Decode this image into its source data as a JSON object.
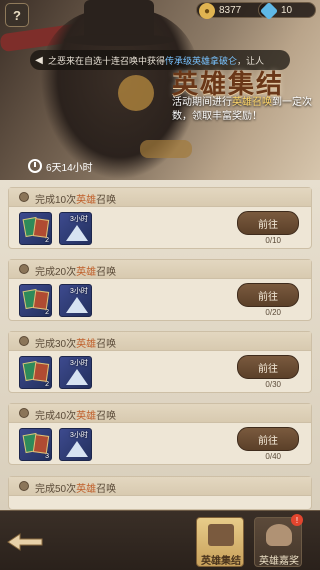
{
  "resources": {
    "gold": "8377",
    "gems": "10"
  },
  "marquee": {
    "text_prefix": "之恶来在自选十连召唤中获得",
    "text_highlight": "传承级英雄拿破仑",
    "text_suffix": "，让人"
  },
  "banner": {
    "title": "英雄集结",
    "desc_prefix": "活动期间进行",
    "desc_highlight": "英雄召唤",
    "desc_suffix": "到一定次数，领取丰富奖励！",
    "countdown": "6天14小时"
  },
  "tasks": [
    {
      "label_prefix": "完成",
      "count": "10次",
      "highlight": "英雄",
      "label_suffix": "召唤",
      "card_qty": "2",
      "tent_label": "3小时",
      "button": "前往",
      "progress": "0/10"
    },
    {
      "label_prefix": "完成",
      "count": "20次",
      "highlight": "英雄",
      "label_suffix": "召唤",
      "card_qty": "2",
      "tent_label": "3小时",
      "button": "前往",
      "progress": "0/20"
    },
    {
      "label_prefix": "完成",
      "count": "30次",
      "highlight": "英雄",
      "label_suffix": "召唤",
      "card_qty": "2",
      "tent_label": "3小时",
      "button": "前往",
      "progress": "0/30"
    },
    {
      "label_prefix": "完成",
      "count": "40次",
      "highlight": "英雄",
      "label_suffix": "召唤",
      "card_qty": "3",
      "tent_label": "3小时",
      "button": "前往",
      "progress": "0/40"
    },
    {
      "label_prefix": "完成",
      "count": "50次",
      "highlight": "英雄",
      "label_suffix": "召唤",
      "card_qty": "",
      "tent_label": "",
      "button": "",
      "progress": ""
    }
  ],
  "nav": {
    "tab1": "英雄集结",
    "tab2": "英雄嘉奖",
    "badge": "!"
  },
  "colors": {
    "accent_orange": "#c0602c",
    "gold_button": "#c8a15b",
    "highlight_blue": "#79c3ff"
  },
  "icons": {
    "help": "question-mark",
    "gold": "coin",
    "gems": "diamond",
    "back": "arrow-left"
  }
}
